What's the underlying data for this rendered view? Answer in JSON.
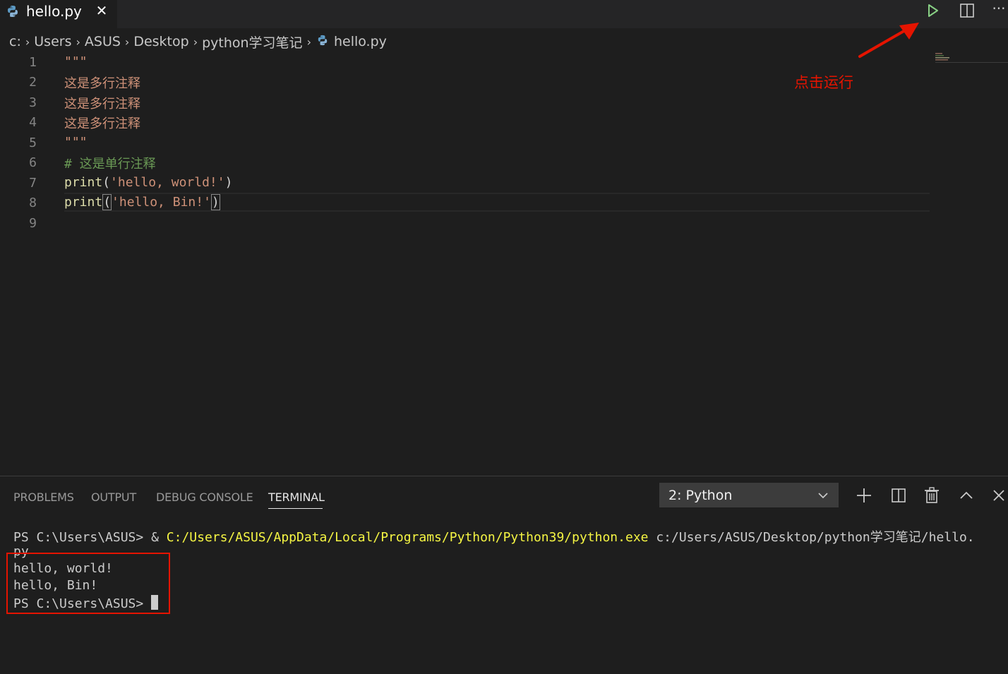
{
  "tab": {
    "filename": "hello.py",
    "close_glyph": "✕",
    "file_icon": "python-icon"
  },
  "toolbar": {
    "run_icon": "run-play-icon",
    "split_icon": "split-editor-icon",
    "more_label": "···"
  },
  "breadcrumb": {
    "items": [
      "c:",
      "Users",
      "ASUS",
      "Desktop",
      "python学习笔记",
      "hello.py"
    ],
    "separator": "›"
  },
  "editor": {
    "line_numbers": [
      "1",
      "2",
      "3",
      "4",
      "5",
      "6",
      "7",
      "8",
      "9"
    ],
    "lines": {
      "l1": "\"\"\"",
      "l2": "这是多行注释",
      "l3": "这是多行注释",
      "l4": "这是多行注释",
      "l5": "\"\"\"",
      "l6": "# 这是单行注释",
      "l7_fn": "print",
      "l7_open": "(",
      "l7_str": "'hello, world!'",
      "l7_close": ")",
      "l8_fn": "print",
      "l8_open": "(",
      "l8_str": "'hello, Bin!'",
      "l8_close": ")"
    }
  },
  "annotation": {
    "text": "点击运行",
    "color": "#e51400"
  },
  "panel": {
    "tabs": [
      "PROBLEMS",
      "OUTPUT",
      "DEBUG CONSOLE",
      "TERMINAL"
    ],
    "active_tab": "TERMINAL",
    "terminal_select": "2: Python",
    "icons": [
      "add-terminal-icon",
      "split-terminal-icon",
      "trash-icon",
      "maximize-panel-icon",
      "close-panel-icon"
    ]
  },
  "terminal": {
    "prompt1": "PS C:\\Users\\ASUS> ",
    "amp": "& ",
    "exe": "C:/Users/ASUS/AppData/Local/Programs/Python/Python39/python.exe",
    "arg": " c:/Users/ASUS/Desktop/python学习笔记/hello.",
    "wrap": "py",
    "out1": "hello, world!",
    "out2": "hello, Bin!",
    "prompt2": "PS C:\\Users\\ASUS> "
  },
  "colors": {
    "background": "#1e1e1e",
    "string": "#ce9178",
    "comment": "#6a9955",
    "function": "#dcdcaa",
    "run_green": "#89d185",
    "annotation_red": "#e51400"
  }
}
